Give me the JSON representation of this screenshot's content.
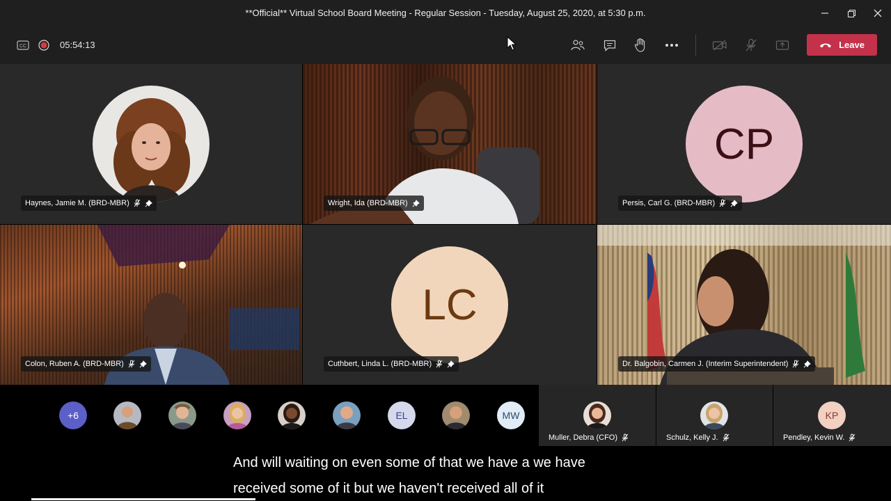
{
  "window": {
    "title": "**Official** Virtual School Board Meeting - Regular Session - Tuesday, August 25, 2020, at 5:30 p.m."
  },
  "toolbar": {
    "timer": "05:54:13",
    "leave_label": "Leave",
    "icons": [
      "closed-caption-icon",
      "recording-icon",
      "participants-icon",
      "chat-icon",
      "raise-hand-icon",
      "more-icon",
      "camera-off-icon",
      "mic-off-icon",
      "share-screen-icon",
      "phone-hangup-icon"
    ],
    "leave_color": "#c4314b"
  },
  "tiles": [
    {
      "name": "Haynes, Jamie M. (BRD-MBR)",
      "type": "photo-avatar"
    },
    {
      "name": "Wright, Ida (BRD-MBR)",
      "type": "video"
    },
    {
      "name": "Persis, Carl G. (BRD-MBR)",
      "type": "initials-avatar",
      "initials": "CP",
      "bg": "#e5bcc5",
      "fg": "#3d0f14"
    },
    {
      "name": "Colon, Ruben A. (BRD-MBR)",
      "type": "video"
    },
    {
      "name": "Cuthbert, Linda L. (BRD-MBR)",
      "type": "initials-avatar",
      "initials": "LC",
      "bg": "#f2d6bc",
      "fg": "#6b3a10"
    },
    {
      "name": "Dr. Balgobin, Carmen J. (Interim Superintendent)",
      "type": "video"
    }
  ],
  "participant_bar": {
    "overflow_count": "+6",
    "avatars": [
      {
        "kind": "photo"
      },
      {
        "kind": "photo"
      },
      {
        "kind": "photo"
      },
      {
        "kind": "photo"
      },
      {
        "kind": "photo"
      },
      {
        "kind": "initials",
        "initials": "EL"
      },
      {
        "kind": "photo"
      },
      {
        "kind": "initials",
        "initials": "MW"
      }
    ],
    "named": [
      {
        "name": "Muller, Debra (CFO)"
      },
      {
        "name": "Schulz, Kelly J."
      },
      {
        "name": "Pendley, Kevin W.",
        "initials": "KP"
      }
    ]
  },
  "caption": {
    "line1": "And will waiting on even some of that we have a we have",
    "line2": "received some of it but we haven't received all of it"
  },
  "playback": {
    "progress_fraction": 0.29
  }
}
